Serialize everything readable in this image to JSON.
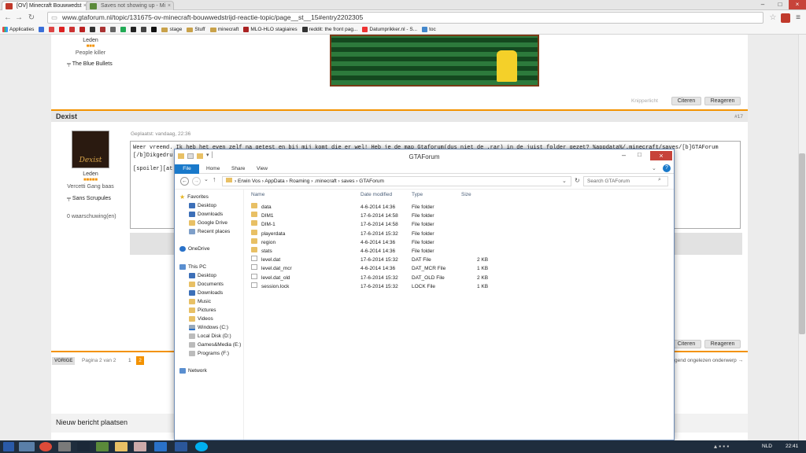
{
  "browser": {
    "tabs": [
      {
        "title": "[OV] Minecraft Bouwwedst"
      },
      {
        "title": "Saves not showing up - Mi"
      }
    ],
    "url": "www.gtaforum.nl/topic/131675-ov-minecraft-bouwwedstrijd-reactie-topic/page__st__15#entry2202305",
    "bookmarks": [
      "Applicaties",
      "stage",
      "Stuff",
      "minecraft",
      "MLO-HLO stagiaires",
      "reddit: the front pag...",
      "Datumprikker.nl - S...",
      "toc"
    ]
  },
  "prev_post": {
    "group": "Leden",
    "title": "People killer",
    "team": "The Blue Bullets",
    "buttons": {
      "quote": "Citeren",
      "reply": "Reageren"
    },
    "multiquote": "Knipperlicht"
  },
  "post": {
    "author": "Dexist",
    "number": "#17",
    "posted": "Geplaatst: vandaag, 22:36",
    "avatar_text": "Dexist",
    "group": "Leden",
    "rank": "Vercetti Gang baas",
    "team": "Sans Scrupules",
    "warnings": "0 waarschuwing(en)",
    "body_line1": "Weer vreemd. Ik heb het even zelf na getest en bij mij komt die er wel!  Heb je de map Gtaforum(dus niet de .rar) in de juist folder gezet?  %appdata%/.minecraft/saves/[b]GTAForum",
    "body_line2": "[/b]Dikgedru",
    "body_line3": "[spoiler][at"
  },
  "pagination": {
    "prev": "VORIGE",
    "label": "Pagina 2 van 2",
    "pages": [
      "1",
      "2"
    ],
    "next_topic": "gend ongelezen onderwerp →"
  },
  "new_post_heading": "Nieuw bericht plaatsen",
  "explorer": {
    "title": "GTAForum",
    "ribbon_tabs": [
      "File",
      "Home",
      "Share",
      "View"
    ],
    "path": [
      "Erwin Vos",
      "AppData",
      "Roaming",
      ".minecraft",
      "saves",
      "GTAForum"
    ],
    "search_placeholder": "Search GTAForum",
    "columns": {
      "name": "Name",
      "date": "Date modified",
      "type": "Type",
      "size": "Size"
    },
    "nav": {
      "favorites": "Favorites",
      "fav_items": [
        "Desktop",
        "Downloads",
        "Google Drive",
        "Recent places"
      ],
      "onedrive": "OneDrive",
      "thispc": "This PC",
      "pc_items": [
        "Desktop",
        "Documents",
        "Downloads",
        "Music",
        "Pictures",
        "Videos",
        "Windows (C:)",
        "Local Disk (D:)",
        "Games&Media (E:)",
        "Programs (F:)"
      ],
      "network": "Network"
    },
    "files": [
      {
        "name": "data",
        "date": "4-6-2014 14:36",
        "type": "File folder",
        "size": "",
        "kind": "folder"
      },
      {
        "name": "DIM1",
        "date": "17-6-2014 14:58",
        "type": "File folder",
        "size": "",
        "kind": "folder"
      },
      {
        "name": "DIM-1",
        "date": "17-6-2014 14:58",
        "type": "File folder",
        "size": "",
        "kind": "folder"
      },
      {
        "name": "playerdata",
        "date": "17-6-2014 15:32",
        "type": "File folder",
        "size": "",
        "kind": "folder"
      },
      {
        "name": "region",
        "date": "4-6-2014 14:36",
        "type": "File folder",
        "size": "",
        "kind": "folder"
      },
      {
        "name": "stats",
        "date": "4-6-2014 14:36",
        "type": "File folder",
        "size": "",
        "kind": "folder"
      },
      {
        "name": "level.dat",
        "date": "17-6-2014 15:32",
        "type": "DAT File",
        "size": "2 KB",
        "kind": "file"
      },
      {
        "name": "level.dat_mcr",
        "date": "4-6-2014 14:36",
        "type": "DAT_MCR File",
        "size": "1 KB",
        "kind": "file"
      },
      {
        "name": "level.dat_old",
        "date": "17-6-2014 15:32",
        "type": "DAT_OLD File",
        "size": "2 KB",
        "kind": "file"
      },
      {
        "name": "session.lock",
        "date": "17-6-2014 15:32",
        "type": "LOCK File",
        "size": "1 KB",
        "kind": "file"
      }
    ]
  },
  "taskbar": {
    "lang": "NLD",
    "time": "22:41"
  },
  "colors": {
    "accent": "#f39200",
    "explorer_file_tab": "#1979ca",
    "taskbar": "#1f2d3d"
  }
}
